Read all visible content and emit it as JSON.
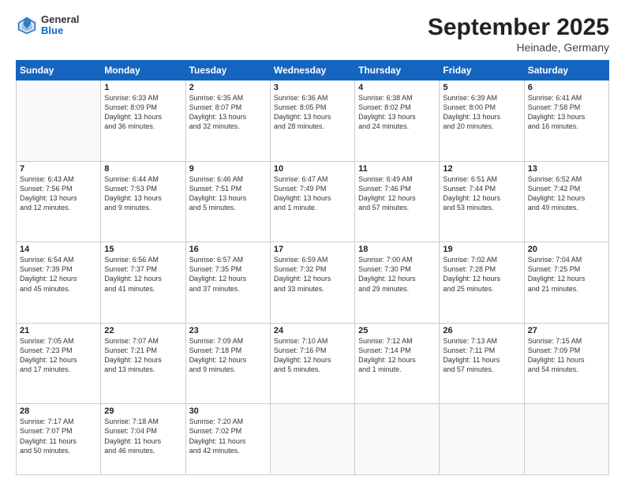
{
  "header": {
    "logo": {
      "general": "General",
      "blue": "Blue"
    },
    "title": "September 2025",
    "location": "Heinade, Germany"
  },
  "weekdays": [
    "Sunday",
    "Monday",
    "Tuesday",
    "Wednesday",
    "Thursday",
    "Friday",
    "Saturday"
  ],
  "weeks": [
    [
      {
        "day": "",
        "info": ""
      },
      {
        "day": "1",
        "info": "Sunrise: 6:33 AM\nSunset: 8:09 PM\nDaylight: 13 hours\nand 36 minutes."
      },
      {
        "day": "2",
        "info": "Sunrise: 6:35 AM\nSunset: 8:07 PM\nDaylight: 13 hours\nand 32 minutes."
      },
      {
        "day": "3",
        "info": "Sunrise: 6:36 AM\nSunset: 8:05 PM\nDaylight: 13 hours\nand 28 minutes."
      },
      {
        "day": "4",
        "info": "Sunrise: 6:38 AM\nSunset: 8:02 PM\nDaylight: 13 hours\nand 24 minutes."
      },
      {
        "day": "5",
        "info": "Sunrise: 6:39 AM\nSunset: 8:00 PM\nDaylight: 13 hours\nand 20 minutes."
      },
      {
        "day": "6",
        "info": "Sunrise: 6:41 AM\nSunset: 7:58 PM\nDaylight: 13 hours\nand 16 minutes."
      }
    ],
    [
      {
        "day": "7",
        "info": "Sunrise: 6:43 AM\nSunset: 7:56 PM\nDaylight: 13 hours\nand 12 minutes."
      },
      {
        "day": "8",
        "info": "Sunrise: 6:44 AM\nSunset: 7:53 PM\nDaylight: 13 hours\nand 9 minutes."
      },
      {
        "day": "9",
        "info": "Sunrise: 6:46 AM\nSunset: 7:51 PM\nDaylight: 13 hours\nand 5 minutes."
      },
      {
        "day": "10",
        "info": "Sunrise: 6:47 AM\nSunset: 7:49 PM\nDaylight: 13 hours\nand 1 minute."
      },
      {
        "day": "11",
        "info": "Sunrise: 6:49 AM\nSunset: 7:46 PM\nDaylight: 12 hours\nand 57 minutes."
      },
      {
        "day": "12",
        "info": "Sunrise: 6:51 AM\nSunset: 7:44 PM\nDaylight: 12 hours\nand 53 minutes."
      },
      {
        "day": "13",
        "info": "Sunrise: 6:52 AM\nSunset: 7:42 PM\nDaylight: 12 hours\nand 49 minutes."
      }
    ],
    [
      {
        "day": "14",
        "info": "Sunrise: 6:54 AM\nSunset: 7:39 PM\nDaylight: 12 hours\nand 45 minutes."
      },
      {
        "day": "15",
        "info": "Sunrise: 6:56 AM\nSunset: 7:37 PM\nDaylight: 12 hours\nand 41 minutes."
      },
      {
        "day": "16",
        "info": "Sunrise: 6:57 AM\nSunset: 7:35 PM\nDaylight: 12 hours\nand 37 minutes."
      },
      {
        "day": "17",
        "info": "Sunrise: 6:59 AM\nSunset: 7:32 PM\nDaylight: 12 hours\nand 33 minutes."
      },
      {
        "day": "18",
        "info": "Sunrise: 7:00 AM\nSunset: 7:30 PM\nDaylight: 12 hours\nand 29 minutes."
      },
      {
        "day": "19",
        "info": "Sunrise: 7:02 AM\nSunset: 7:28 PM\nDaylight: 12 hours\nand 25 minutes."
      },
      {
        "day": "20",
        "info": "Sunrise: 7:04 AM\nSunset: 7:25 PM\nDaylight: 12 hours\nand 21 minutes."
      }
    ],
    [
      {
        "day": "21",
        "info": "Sunrise: 7:05 AM\nSunset: 7:23 PM\nDaylight: 12 hours\nand 17 minutes."
      },
      {
        "day": "22",
        "info": "Sunrise: 7:07 AM\nSunset: 7:21 PM\nDaylight: 12 hours\nand 13 minutes."
      },
      {
        "day": "23",
        "info": "Sunrise: 7:09 AM\nSunset: 7:18 PM\nDaylight: 12 hours\nand 9 minutes."
      },
      {
        "day": "24",
        "info": "Sunrise: 7:10 AM\nSunset: 7:16 PM\nDaylight: 12 hours\nand 5 minutes."
      },
      {
        "day": "25",
        "info": "Sunrise: 7:12 AM\nSunset: 7:14 PM\nDaylight: 12 hours\nand 1 minute."
      },
      {
        "day": "26",
        "info": "Sunrise: 7:13 AM\nSunset: 7:11 PM\nDaylight: 11 hours\nand 57 minutes."
      },
      {
        "day": "27",
        "info": "Sunrise: 7:15 AM\nSunset: 7:09 PM\nDaylight: 11 hours\nand 54 minutes."
      }
    ],
    [
      {
        "day": "28",
        "info": "Sunrise: 7:17 AM\nSunset: 7:07 PM\nDaylight: 11 hours\nand 50 minutes."
      },
      {
        "day": "29",
        "info": "Sunrise: 7:18 AM\nSunset: 7:04 PM\nDaylight: 11 hours\nand 46 minutes."
      },
      {
        "day": "30",
        "info": "Sunrise: 7:20 AM\nSunset: 7:02 PM\nDaylight: 11 hours\nand 42 minutes."
      },
      {
        "day": "",
        "info": ""
      },
      {
        "day": "",
        "info": ""
      },
      {
        "day": "",
        "info": ""
      },
      {
        "day": "",
        "info": ""
      }
    ]
  ]
}
